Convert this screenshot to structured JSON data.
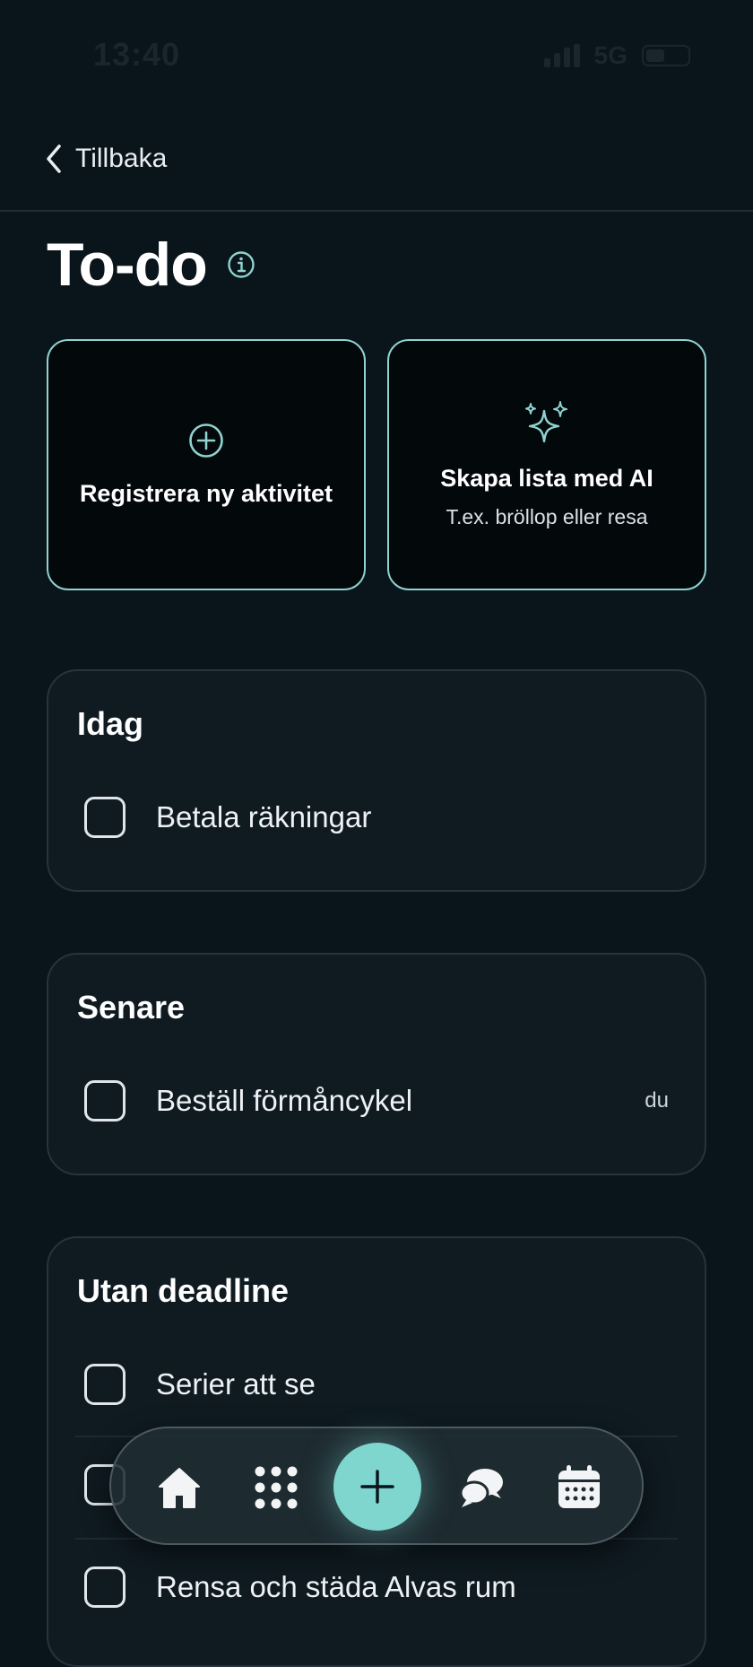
{
  "status_bar": {
    "time": "13:40",
    "network": "5G"
  },
  "header": {
    "back_label": "Tillbaka",
    "back_icon": "chevron-left-icon"
  },
  "page": {
    "title": "To-do",
    "info_icon": "info-icon"
  },
  "actions": [
    {
      "title": "Registrera ny aktivitet",
      "icon": "plus-circle-icon"
    },
    {
      "title": "Skapa lista med AI",
      "subtitle": "T.ex. bröllop eller resa",
      "icon": "sparkles-icon"
    }
  ],
  "sections": [
    {
      "title": "Idag",
      "items": [
        {
          "label": "Betala räkningar",
          "checked": false
        }
      ]
    },
    {
      "title": "Senare",
      "items": [
        {
          "label": "Beställ förmåncykel",
          "meta": "du",
          "checked": false
        }
      ]
    },
    {
      "title": "Utan deadline",
      "items": [
        {
          "label": "Serier att se",
          "checked": false
        },
        {
          "label": "",
          "checked": false
        },
        {
          "label": "Rensa och städa Alvas rum",
          "checked": false
        }
      ]
    }
  ],
  "bottom_nav": {
    "items": [
      "home-icon",
      "apps-grid-icon",
      "add-icon",
      "chat-icon",
      "calendar-icon"
    ],
    "accent": "#7ed6cf"
  },
  "colors": {
    "background": "#0a141b",
    "accent": "#8fd3cf",
    "section_bg": "#0f1a21"
  }
}
